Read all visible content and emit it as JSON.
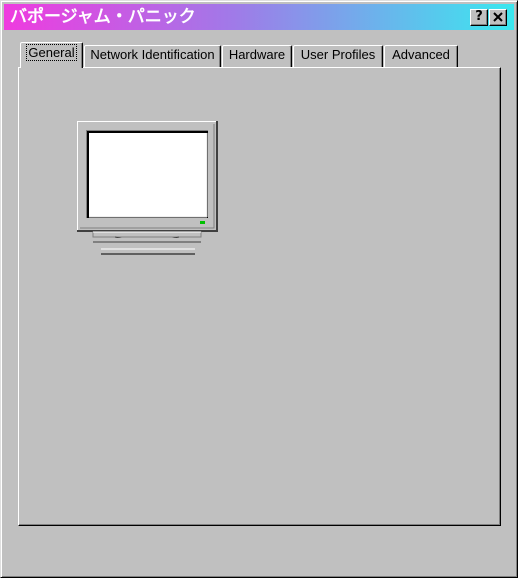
{
  "window": {
    "title": "バポージャム・パニック",
    "help_button": "?",
    "close_button": "✕"
  },
  "tabs": [
    {
      "label": "General",
      "active": true
    },
    {
      "label": "Network Identification",
      "active": false
    },
    {
      "label": "Hardware",
      "active": false
    },
    {
      "label": "User Profiles",
      "active": false
    },
    {
      "label": "Advanced",
      "active": false
    }
  ],
  "icons": {
    "computer": "computer-monitor-icon"
  },
  "colors": {
    "title_gradient_start": "#ef3bdf",
    "title_gradient_end": "#3ae8ef",
    "face": "#c0c0c0",
    "power_led": "#00c000"
  }
}
